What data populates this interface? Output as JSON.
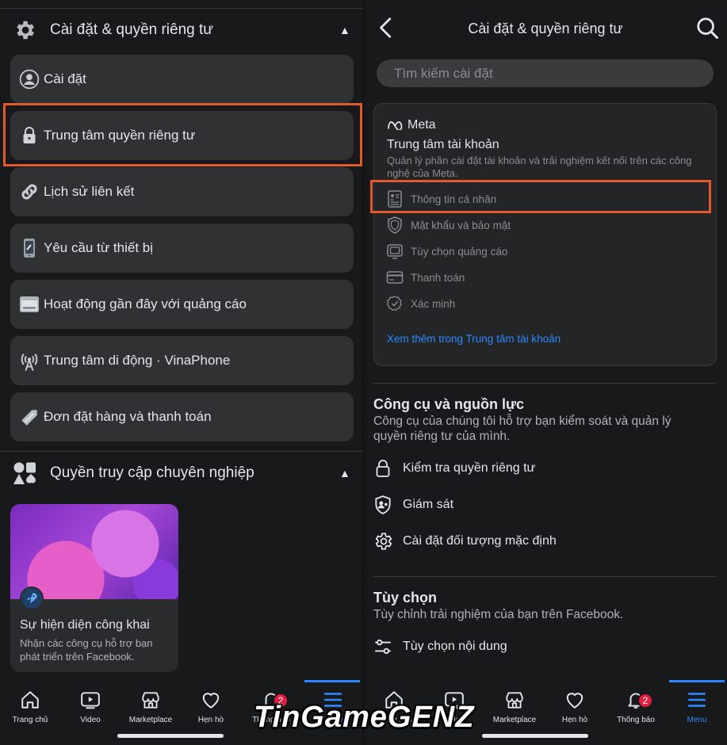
{
  "left": {
    "settings_section": {
      "title": "Cài đặt & quyền riêng tư",
      "icon": "gear-icon"
    },
    "settings_items": [
      {
        "label": "Cài đặt",
        "icon": "profile-icon"
      },
      {
        "label": "Trung tâm quyền riêng tư",
        "icon": "lock-icon"
      },
      {
        "label": "Lịch sử liên kết",
        "icon": "link-icon"
      },
      {
        "label": "Yêu cầu từ thiết bị",
        "icon": "phone-icon"
      },
      {
        "label": "Hoạt động gần đây với quảng cáo",
        "icon": "ad-activity-icon"
      },
      {
        "label": "Trung tâm di động · VinaPhone",
        "icon": "antenna-icon"
      },
      {
        "label": "Đơn đặt hàng và thanh toán",
        "icon": "tag-icon"
      }
    ],
    "pro_section": {
      "title": "Quyền truy cập chuyên nghiệp",
      "icon": "shapes-icon"
    },
    "promo": {
      "title": "Sự hiện diện công khai",
      "description": "Nhận các công cụ hỗ trợ bạn phát triển trên Facebook."
    }
  },
  "right": {
    "header": {
      "title": "Cài đặt & quyền riêng tư"
    },
    "search": {
      "placeholder": "Tìm kiếm cài đặt"
    },
    "accounts_center": {
      "brand": "Meta",
      "title": "Trung tâm tài khoản",
      "description": "Quản lý phần cài đặt tài khoản và trải nghiệm kết nối trên các công nghệ của Meta.",
      "items": [
        {
          "label": "Thông tin cá nhân",
          "icon": "id-card-icon"
        },
        {
          "label": "Mật khẩu và bảo mật",
          "icon": "shield-icon"
        },
        {
          "label": "Tùy chọn quảng cáo",
          "icon": "monitor-icon"
        },
        {
          "label": "Thanh toán",
          "icon": "credit-card-icon"
        },
        {
          "label": "Xác minh",
          "icon": "verified-icon"
        }
      ],
      "link": "Xem thêm trong Trung tâm tài khoản"
    },
    "tools": {
      "title": "Công cụ và nguồn lực",
      "description": "Công cụ của chúng tôi hỗ trợ bạn kiểm soát và quản lý quyền riêng tư của mình.",
      "items": [
        {
          "label": "Kiểm tra quyền riêng tư",
          "icon": "lock-icon"
        },
        {
          "label": "Giám sát",
          "icon": "supervision-icon"
        },
        {
          "label": "Cài đặt đối tượng mặc định",
          "icon": "gear-icon"
        }
      ]
    },
    "preferences": {
      "title": "Tùy chọn",
      "description": "Tùy chỉnh trải nghiệm của bạn trên Facebook.",
      "items": [
        {
          "label": "Tùy chọn nội dung",
          "icon": "sliders-icon"
        }
      ]
    }
  },
  "tabs_left": [
    {
      "label": "Trang chủ",
      "icon": "home-icon"
    },
    {
      "label": "Video",
      "icon": "video-icon"
    },
    {
      "label": "Marketplace",
      "icon": "shop-icon"
    },
    {
      "label": "Hẹn hò",
      "icon": "heart-icon"
    },
    {
      "label": "Thông báo",
      "icon": "bell-icon",
      "badge": "2"
    },
    {
      "label": "Menu",
      "icon": "menu-icon"
    }
  ],
  "tabs_right": [
    {
      "label": "Trang chủ",
      "icon": "home-icon"
    },
    {
      "label": "Video",
      "icon": "video-icon"
    },
    {
      "label": "Marketplace",
      "icon": "shop-icon"
    },
    {
      "label": "Hẹn hò",
      "icon": "heart-icon"
    },
    {
      "label": "Thông báo",
      "icon": "bell-icon",
      "badge": "2"
    },
    {
      "label": "Menu",
      "icon": "menu-icon"
    }
  ],
  "watermark": "TinGameGENZ",
  "colors": {
    "highlight": "#e25a2c",
    "accent": "#2d88ff",
    "background": "#18191a",
    "card": "#303133"
  }
}
